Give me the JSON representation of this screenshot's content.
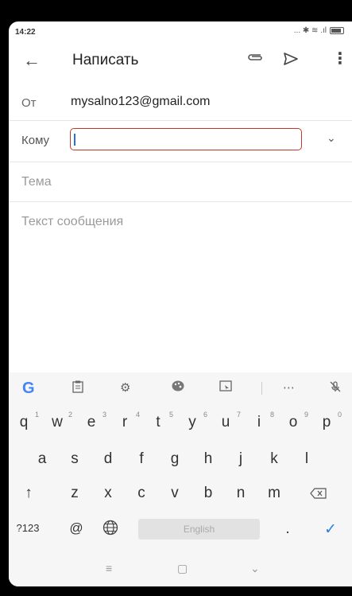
{
  "status": {
    "time": "14:22",
    "icons_text": "... ✱ ≋ .ıl"
  },
  "appbar": {
    "title": "Написать",
    "back_icon": "arrow-back-icon",
    "attach_icon": "paperclip-icon",
    "send_icon": "send-icon",
    "more_icon": "more-vert-icon"
  },
  "compose": {
    "from_label": "От",
    "from_value": "mysalno123@gmail.com",
    "to_label": "Кому",
    "to_value": "",
    "subject_placeholder": "Тема",
    "body_placeholder": "Текст сообщения"
  },
  "keyboard": {
    "toolbar": [
      "G",
      "clipboard-icon",
      "settings-icon",
      "palette-icon",
      "screenshot-icon",
      "more-icon",
      "mic-off-icon"
    ],
    "row1": [
      {
        "k": "q",
        "n": "1"
      },
      {
        "k": "w",
        "n": "2"
      },
      {
        "k": "e",
        "n": "3"
      },
      {
        "k": "r",
        "n": "4"
      },
      {
        "k": "t",
        "n": "5"
      },
      {
        "k": "y",
        "n": "6"
      },
      {
        "k": "u",
        "n": "7"
      },
      {
        "k": "i",
        "n": "8"
      },
      {
        "k": "o",
        "n": "9"
      },
      {
        "k": "p",
        "n": "0"
      }
    ],
    "row2": [
      "a",
      "s",
      "d",
      "f",
      "g",
      "h",
      "j",
      "k",
      "l"
    ],
    "row3": [
      "z",
      "x",
      "c",
      "v",
      "b",
      "n",
      "m"
    ],
    "symbols_key": "?123",
    "at_key": "@",
    "space_label": "English",
    "period_key": ".",
    "enter_icon": "check-icon"
  }
}
